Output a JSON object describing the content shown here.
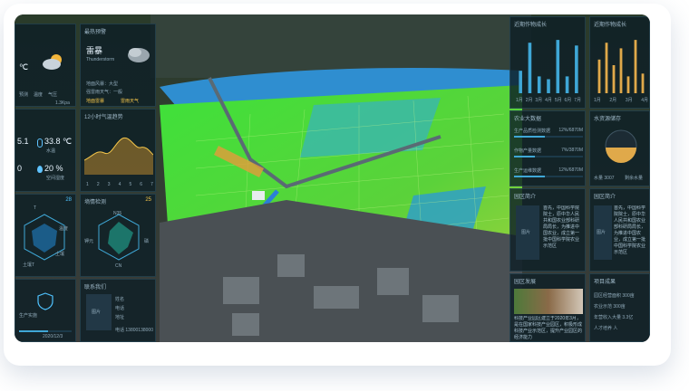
{
  "weather": {
    "title": "预警监测",
    "temp_small": "℃",
    "legend": [
      "预测",
      "温度",
      "气压"
    ],
    "pressure": "1.3Kpa",
    "alert_title": "最热预警",
    "alert_name": "雷暴",
    "alert_name_en": "Thunderstorm",
    "alert_notes": [
      "地面风暴：大型",
      "强雷雨天气：一般"
    ],
    "alert_tags": [
      "地面雷暴",
      "雷雨天气"
    ]
  },
  "env": {
    "value1": "5.1",
    "value2": "0",
    "temp": "33.8 ℃",
    "temp_label": "水温",
    "humidity": "20 %",
    "humidity_label": "空间湿度",
    "chart_title": "12小时气温趋势",
    "xticks": [
      "1",
      "2",
      "3",
      "4",
      "5",
      "6",
      "7"
    ]
  },
  "radar": {
    "badge_left": "28",
    "title": "墒情检测",
    "badge_right": "25",
    "labels_left": [
      "T",
      "温度",
      "土壤T",
      "土壤"
    ],
    "labels_right": [
      "N35",
      "K",
      "P",
      "CN"
    ],
    "mid_left": "钾元",
    "mid_right": "磷"
  },
  "bottom_left": {
    "title": "生产实施",
    "date": "2020/12/3"
  },
  "contact": {
    "title": "联系我们",
    "photo_label": "图片",
    "rows": [
      "姓名",
      "电话",
      "地址",
      "电话 13800138000"
    ]
  },
  "bars1": {
    "title": "近期作物成长",
    "xticks": [
      "1月",
      "2月",
      "3月",
      "4月",
      "5月",
      "6月",
      "7月"
    ],
    "values": [
      40,
      90,
      30,
      25,
      95,
      30,
      85
    ]
  },
  "bars2": {
    "title": "近期作物成长",
    "xticks": [
      "1月",
      "2月",
      "3月",
      "4月",
      "5月",
      "6月",
      "7月"
    ],
    "values": [
      60,
      90,
      50,
      80,
      30,
      95,
      35
    ]
  },
  "indicators": {
    "title": "农业大数据",
    "rows": [
      {
        "label": "生产品质检测数据",
        "value": "12%/6870M",
        "pct": 0.45
      },
      {
        "label": "作物产量数据",
        "value": "7%/3870M",
        "pct": 0.3
      },
      {
        "label": "生产运维数据",
        "value": "12%/6870M",
        "pct": 0.45
      }
    ]
  },
  "water": {
    "title": "水资源储存",
    "stat1": "水量 3007",
    "stat2": "剩余水量"
  },
  "intro1": {
    "title": "园区简介",
    "photo_label": "图片",
    "text": "首先，中国科学院院士，原中华人民共和国农业部科研局局长，为推进中国农业，成立第一批中国科学院农业示范区"
  },
  "intro2": {
    "title": "园区简介",
    "photo_label": "图片",
    "text": "首先，中国科学院院士，原中华人民共和国农业部科研局局长，为推进中国农业，成立第一批中国科学院农业示范区"
  },
  "park": {
    "title": "园区发展",
    "text": "科技产业园区建立于2020年3月，是在国家科技产业园区，积极形成科技产业示范区，提升产业园区的经济能力"
  },
  "results": {
    "title": "项目成果",
    "items": [
      "园区经营面积 300亩",
      "农业示范 300亩",
      "年营收入大量 3.3亿",
      "人才培养 人"
    ]
  }
}
